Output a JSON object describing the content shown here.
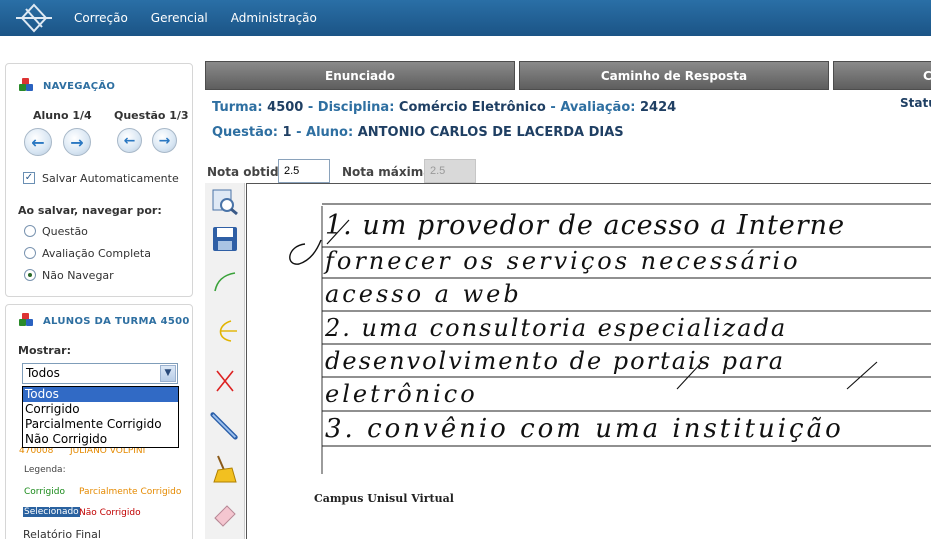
{
  "topnav": [
    "Correção",
    "Gerencial",
    "Administração"
  ],
  "nav": {
    "title": "NAVEGAÇÃO",
    "aluno": "Aluno 1/4",
    "questao": "Questão 1/3",
    "autosave": "Salvar Automaticamente",
    "save_nav_label": "Ao salvar, navegar por:",
    "options": [
      "Questão",
      "Avaliação Completa",
      "Não Navegar"
    ],
    "selected_option": "Não Navegar"
  },
  "alunos": {
    "title": "ALUNOS DA TURMA 4500",
    "show_label": "Mostrar:",
    "selected": "Todos",
    "options": [
      "Todos",
      "Corrigido",
      "Parcialmente Corrigido",
      "Não Corrigido"
    ],
    "partial_row": {
      "id": "470008",
      "name": "JULIANO VOLPINI"
    },
    "legend_label": "Legenda:",
    "legend": {
      "corrigido": "Corrigido",
      "parcial": "Parcialmente Corrigido",
      "selecionado": "Selecionado",
      "nao_corrigido": "Não Corrigido"
    },
    "relatorio": "Relatório Final"
  },
  "tabs": [
    "Enunciado",
    "Caminho de Resposta",
    "Co"
  ],
  "info": {
    "turma_label": "Turma:",
    "turma": "4500",
    "disciplina_label": "Disciplina:",
    "disciplina": "Comércio Eletrônico",
    "avaliacao_label": "Avaliação:",
    "avaliacao": "2424",
    "questao_label": "Questão:",
    "questao": "1",
    "aluno_label": "Aluno:",
    "aluno": "ANTONIO CARLOS DE LACERDA DIAS",
    "status": "Statu"
  },
  "grades": {
    "obtida_label": "Nota obtida:",
    "obtida": "2.5",
    "maxima_label": "Nota máxima:",
    "maxima": "2.5"
  },
  "answer": {
    "lines": [
      "1. um provedor de acesso a Interne",
      "fornecer os serviços necessário",
      "acesso a web",
      "2. uma consultoria especializada",
      "desenvolvimento de portais para",
      "eletrônico",
      "3. convênio com uma instituição"
    ],
    "footer": "Campus Unisul Virtual"
  },
  "colors": {
    "topbar": "#1b5486",
    "accent": "#2e6fa1",
    "dropdown_selected": "#316ac5"
  }
}
